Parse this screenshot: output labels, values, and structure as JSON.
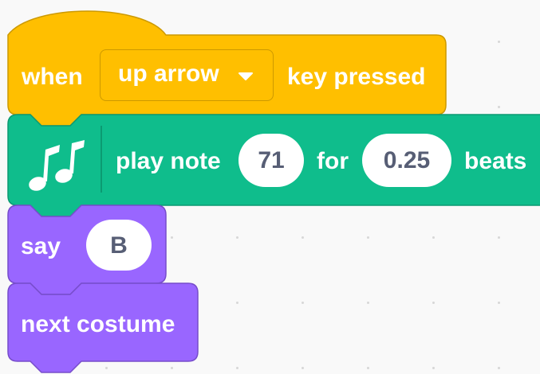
{
  "events_block": {
    "prefix": "when",
    "key_dropdown": "up arrow",
    "suffix": "key pressed"
  },
  "music_block": {
    "icon": "music-notes-icon",
    "label": "play note",
    "note_value": "71",
    "for_label": "for",
    "beats_value": "0.25",
    "beats_label": "beats"
  },
  "say_block": {
    "label": "say",
    "message": "B"
  },
  "costume_block": {
    "label": "next costume"
  },
  "colors": {
    "events": "#ffbf00",
    "events_border": "#cc9900",
    "music": "#0fbd8c",
    "music_border": "#0b9a72",
    "looks": "#9966ff",
    "looks_border": "#774dcb",
    "input_text": "#575e75",
    "workspace": "#f9f9f9"
  }
}
